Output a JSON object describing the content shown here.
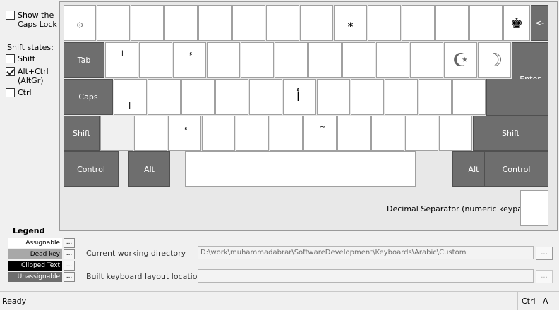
{
  "options": {
    "show_caps_lock": {
      "label": "Show the\nCaps Lock",
      "checked": false
    },
    "shift_states_label": "Shift states:",
    "shift": {
      "label": "Shift",
      "checked": false
    },
    "altgr": {
      "label": "Alt+Ctrl\n(AltGr)",
      "checked": true
    },
    "ctrl": {
      "label": "Ctrl",
      "checked": false
    }
  },
  "keyboard": {
    "row1_glyphs": {
      "first": "۞",
      "asterisk": "*",
      "last": "♚"
    },
    "backspace": "<-",
    "tab": "Tab",
    "row2_glyphs": {
      "k1": "ا",
      "k3": "ء",
      "k11": "☪",
      "k12": "☽"
    },
    "caps": "Caps",
    "enter": "Enter",
    "row3_glyphs": {
      "k1": "ا",
      "k6": "أ"
    },
    "shift_left": "Shift",
    "row4_glyphs": {
      "k3": "ء",
      "k7": "~"
    },
    "shift_right": "Shift",
    "control_left": "Control",
    "alt_left": "Alt",
    "alt_right": "Alt",
    "control_right": "Control",
    "decimal_separator": "Decimal Separator (numeric keypad)"
  },
  "legend": {
    "title": "Legend",
    "assignable": "Assignable",
    "dead_key": "Dead key",
    "clipped_text": "Clipped Text",
    "unassignable": "Unassignable",
    "dots": "..."
  },
  "paths": {
    "cwd_label": "Current working directory",
    "cwd_value": "D:\\work\\muhammadabrar\\SoftwareDevelopment\\Keyboards\\Arabic\\Custom",
    "build_label": "Built keyboard layout location",
    "build_value": "",
    "browse": "..."
  },
  "status": {
    "text": "Ready",
    "ctrl": "Ctrl",
    "a": "A"
  },
  "colors": {
    "assignable": "#ffffff",
    "dead_key": "#a8a8a8",
    "clipped_text": "#000000",
    "unassignable": "#6e6e6e"
  }
}
